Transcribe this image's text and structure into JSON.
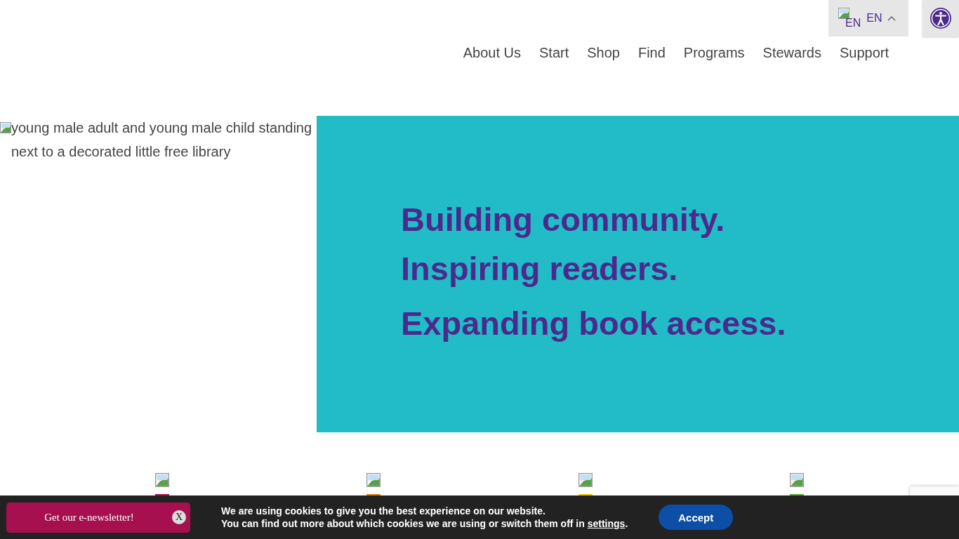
{
  "header": {
    "language": {
      "flag_alt": "EN",
      "label": "EN",
      "expanded": true
    },
    "nav": [
      {
        "label": "About Us"
      },
      {
        "label": "Start"
      },
      {
        "label": "Shop"
      },
      {
        "label": "Find"
      },
      {
        "label": "Programs"
      },
      {
        "label": "Stewards"
      },
      {
        "label": "Support"
      }
    ]
  },
  "hero": {
    "image_alt": "young male adult and young male child standing next to a decorated little free library",
    "headlines": [
      "Building community.",
      "Inspiring readers.",
      "Expanding book access."
    ]
  },
  "features": [
    {
      "color": "#a6104f"
    },
    {
      "color": "#e07b10"
    },
    {
      "color": "#f2c200"
    },
    {
      "color": "#5aa832"
    }
  ],
  "newsletter": {
    "label": "Get our e-newsletter!",
    "close": "X"
  },
  "cookie_bar": {
    "line_1": "We are using cookies to give you the best experience on our website.",
    "line_2_before": "You can find out more about which cookies we are using or switch them off in ",
    "link": "settings",
    "line_2_after": ".",
    "button": "Accept"
  }
}
